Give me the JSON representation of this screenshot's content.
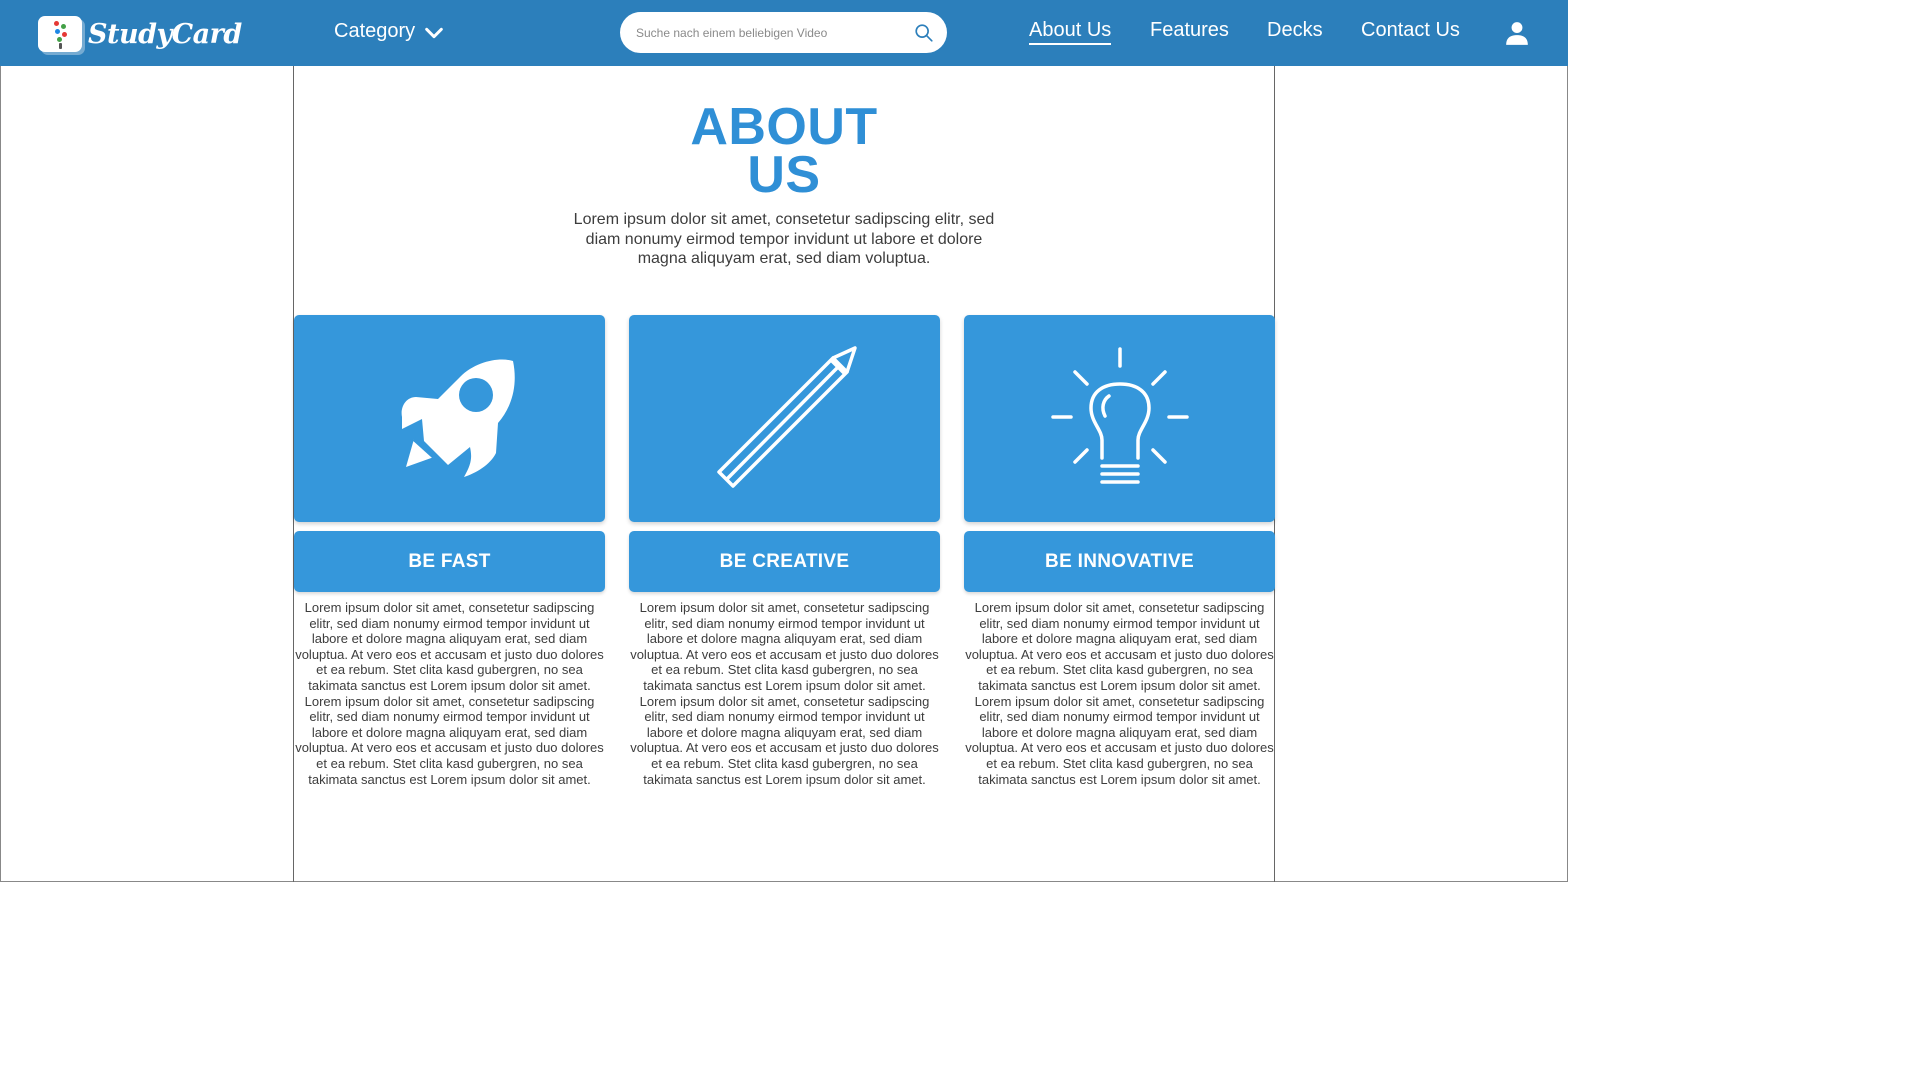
{
  "header": {
    "logo_text": "StudyCard",
    "category_label": "Category",
    "search": {
      "placeholder": "Suche nach einem beliebigen Video"
    },
    "nav": [
      {
        "label": "About Us",
        "active": true
      },
      {
        "label": "Features"
      },
      {
        "label": "Decks"
      },
      {
        "label": "Contact Us"
      }
    ],
    "user_icon": "user-icon"
  },
  "main": {
    "title_line1": "ABOUT",
    "title_line2": "US",
    "intro": "Lorem ipsum dolor sit amet, consetetur sadipscing elitr, sed diam nonumy eirmod tempor invidunt ut labore et dolore magna aliquyam erat, sed diam voluptua.",
    "cards": [
      {
        "icon": "rocket-icon",
        "title": "BE FAST",
        "text": "Lorem ipsum dolor sit amet, consetetur sadipscing elitr, sed diam nonumy eirmod tempor invidunt ut labore et dolore magna aliquyam erat, sed diam voluptua. At vero eos et accusam et justo duo dolores et ea rebum. Stet clita kasd gubergren, no sea takimata sanctus est Lorem ipsum dolor sit amet. Lorem ipsum dolor sit amet, consetetur sadipscing elitr, sed diam nonumy eirmod tempor invidunt ut labore et dolore magna aliquyam erat, sed diam voluptua. At vero eos et accusam et justo duo dolores et ea rebum. Stet clita kasd gubergren, no sea takimata sanctus est Lorem ipsum dolor sit amet."
      },
      {
        "icon": "pencil-icon",
        "title": "BE CREATIVE",
        "text": "Lorem ipsum dolor sit amet, consetetur sadipscing elitr, sed diam nonumy eirmod tempor invidunt ut labore et dolore magna aliquyam erat, sed diam voluptua. At vero eos et accusam et justo duo dolores et ea rebum. Stet clita kasd gubergren, no sea takimata sanctus est Lorem ipsum dolor sit amet. Lorem ipsum dolor sit amet, consetetur sadipscing elitr, sed diam nonumy eirmod tempor invidunt ut labore et dolore magna aliquyam erat, sed diam voluptua. At vero eos et accusam et justo duo dolores et ea rebum. Stet clita kasd gubergren, no sea takimata sanctus est Lorem ipsum dolor sit amet."
      },
      {
        "icon": "lightbulb-icon",
        "title": "BE INNOVATIVE",
        "text": "Lorem ipsum dolor sit amet, consetetur sadipscing elitr, sed diam nonumy eirmod tempor invidunt ut labore et dolore magna aliquyam erat, sed diam voluptua. At vero eos et accusam et justo duo dolores et ea rebum. Stet clita kasd gubergren, no sea takimata sanctus est Lorem ipsum dolor sit amet. Lorem ipsum dolor sit amet, consetetur sadipscing elitr, sed diam nonumy eirmod tempor invidunt ut labore et dolore magna aliquyam erat, sed diam voluptua. At vero eos et accusam et justo duo dolores et ea rebum. Stet clita kasd gubergren, no sea takimata sanctus est Lorem ipsum dolor sit amet."
      }
    ]
  },
  "colors": {
    "header_bg": "#2c7fbb",
    "accent": "#3597db",
    "title": "#2f8fd6"
  }
}
